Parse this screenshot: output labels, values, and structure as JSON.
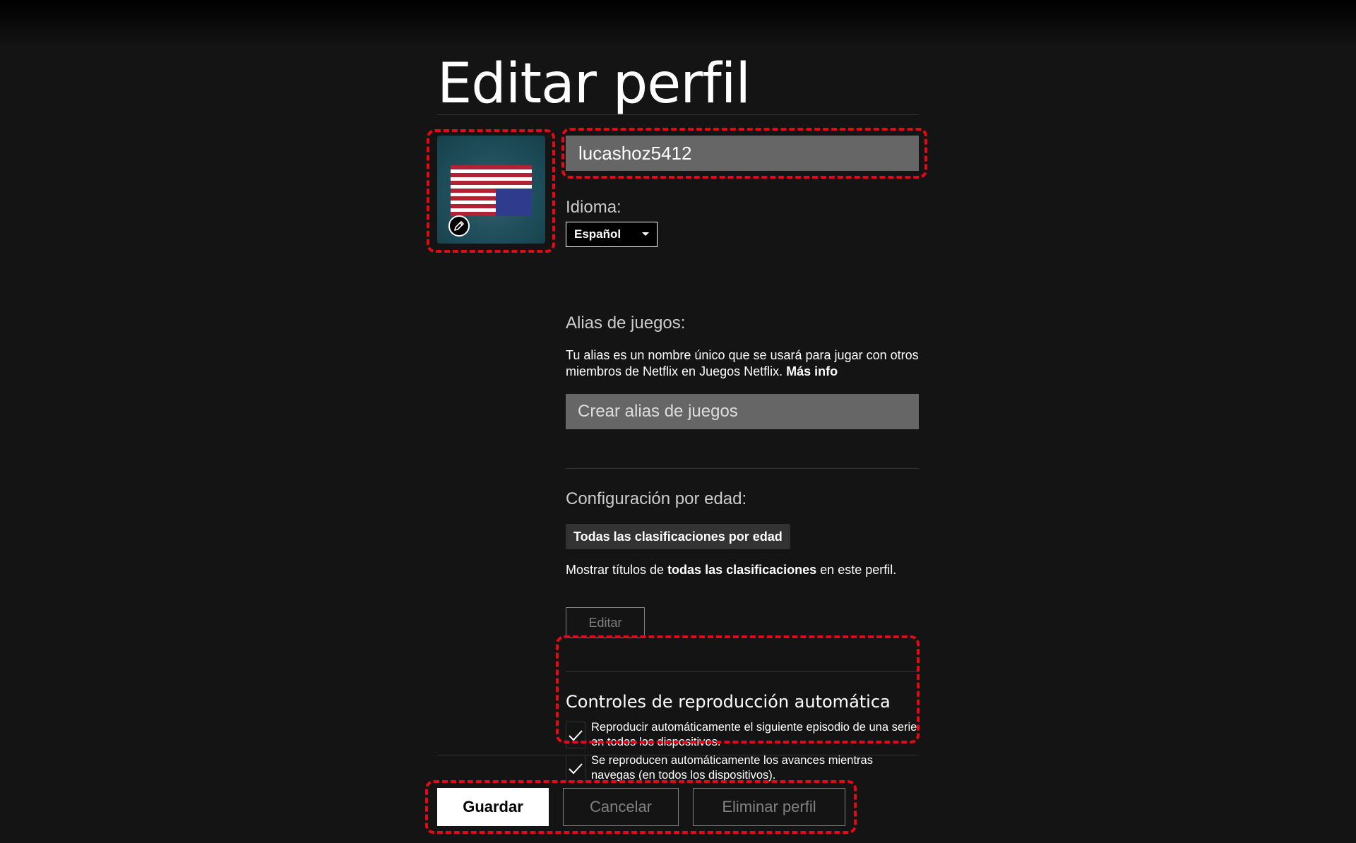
{
  "page": {
    "title": "Editar perfil"
  },
  "profile": {
    "avatar_icon": "flag-avatar",
    "edit_icon": "pencil-icon",
    "name_value": "lucashoz5412"
  },
  "language": {
    "label": "Idioma:",
    "selected": "Español"
  },
  "game_alias": {
    "label": "Alias de juegos:",
    "description": "Tu alias es un nombre único que se usará para jugar con otros miembros de Netflix en Juegos Netflix.",
    "more_info": "Más info",
    "placeholder": "Crear alias de juegos"
  },
  "maturity": {
    "label": "Configuración por edad:",
    "badge": "Todas las clasificaciones por edad",
    "desc_prefix": "Mostrar títulos de ",
    "desc_bold": "todas las clasificaciones",
    "desc_suffix": " en este perfil.",
    "edit_button": "Editar"
  },
  "autoplay": {
    "title": "Controles de reproducción automática",
    "options": [
      {
        "label": "Reproducir automáticamente el siguiente episodio de una serie en todos los dispositivos.",
        "checked": true
      },
      {
        "label": "Se reproducen automáticamente los avances mientras navegas (en todos los dispositivos).",
        "checked": true
      }
    ]
  },
  "actions": {
    "save": "Guardar",
    "cancel": "Cancelar",
    "delete": "Eliminar perfil"
  },
  "colors": {
    "background": "#141414",
    "highlight": "#e50914",
    "input_bg": "#666666",
    "muted": "#808080"
  }
}
